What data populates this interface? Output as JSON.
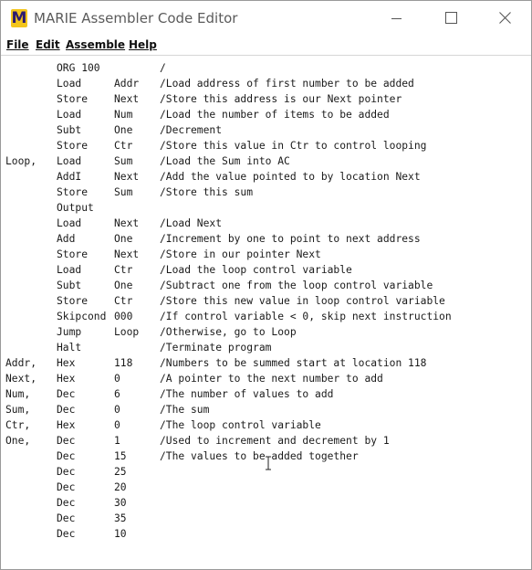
{
  "window": {
    "title": "MARIE Assembler Code Editor",
    "app_icon_letter": "M",
    "controls": {
      "minimize": "minimize",
      "maximize": "maximize",
      "close": "close"
    }
  },
  "menu": {
    "file": "File",
    "edit": "Edit",
    "assemble": "Assemble",
    "help": "Help"
  },
  "code_lines": [
    {
      "label": "",
      "op": "ORG 100",
      "arg": "",
      "comment": "/"
    },
    {
      "label": "",
      "op": "Load",
      "arg": "Addr",
      "comment": "/Load address of first number to be added"
    },
    {
      "label": "",
      "op": "Store",
      "arg": "Next",
      "comment": "/Store this address is our Next pointer"
    },
    {
      "label": "",
      "op": "Load",
      "arg": "Num",
      "comment": "/Load the number of items to be added"
    },
    {
      "label": "",
      "op": "Subt",
      "arg": "One",
      "comment": "/Decrement"
    },
    {
      "label": "",
      "op": "Store",
      "arg": "Ctr",
      "comment": "/Store this value in Ctr to control looping"
    },
    {
      "label": "Loop,",
      "op": "Load",
      "arg": "Sum",
      "comment": "/Load the Sum into AC"
    },
    {
      "label": "",
      "op": "AddI",
      "arg": "Next",
      "comment": "/Add the value pointed to by location Next"
    },
    {
      "label": "",
      "op": "Store",
      "arg": "Sum",
      "comment": "/Store this sum"
    },
    {
      "label": "",
      "op": "Output",
      "arg": "",
      "comment": ""
    },
    {
      "label": "",
      "op": "Load",
      "arg": "Next",
      "comment": "/Load Next"
    },
    {
      "label": "",
      "op": "Add",
      "arg": "One",
      "comment": "/Increment by one to point to next address"
    },
    {
      "label": "",
      "op": "Store",
      "arg": "Next",
      "comment": "/Store in our pointer Next"
    },
    {
      "label": "",
      "op": "Load",
      "arg": "Ctr",
      "comment": "/Load the loop control variable"
    },
    {
      "label": "",
      "op": "Subt",
      "arg": "One",
      "comment": "/Subtract one from the loop control variable"
    },
    {
      "label": "",
      "op": "Store",
      "arg": "Ctr",
      "comment": "/Store this new value in loop control variable"
    },
    {
      "label": "",
      "op": "Skipcond",
      "arg": "000",
      "comment": "/If control variable < 0, skip next instruction"
    },
    {
      "label": "",
      "op": "Jump",
      "arg": "Loop",
      "comment": "/Otherwise, go to Loop"
    },
    {
      "label": "",
      "op": "Halt",
      "arg": "",
      "comment": "/Terminate program"
    },
    {
      "label": "Addr,",
      "op": "Hex",
      "arg": "118",
      "comment": "/Numbers to be summed start at location 118"
    },
    {
      "label": "Next,",
      "op": "Hex",
      "arg": "0",
      "comment": "/A pointer to the next number to add"
    },
    {
      "label": "Num,",
      "op": "Dec",
      "arg": "6",
      "comment": "/The number of values to add"
    },
    {
      "label": "Sum,",
      "op": "Dec",
      "arg": "0",
      "comment": "/The sum"
    },
    {
      "label": "Ctr,",
      "op": "Hex",
      "arg": "0",
      "comment": "/The loop control variable"
    },
    {
      "label": "One,",
      "op": "Dec",
      "arg": "1",
      "comment": "/Used to increment and decrement by 1"
    },
    {
      "label": "",
      "op": "Dec",
      "arg": "15",
      "comment": "/The values to be added together"
    },
    {
      "label": "",
      "op": "Dec",
      "arg": "25",
      "comment": ""
    },
    {
      "label": "",
      "op": "Dec",
      "arg": "20",
      "comment": ""
    },
    {
      "label": "",
      "op": "Dec",
      "arg": "30",
      "comment": ""
    },
    {
      "label": "",
      "op": "Dec",
      "arg": "35",
      "comment": ""
    },
    {
      "label": "",
      "op": "Dec",
      "arg": "10",
      "comment": ""
    }
  ],
  "colors": {
    "icon_bg": "#f3c51c",
    "icon_letter": "#2b1a70",
    "title_text": "#5b5b5b"
  },
  "icons": {
    "app": "marie-app-icon",
    "cursor": "text-cursor-icon"
  }
}
